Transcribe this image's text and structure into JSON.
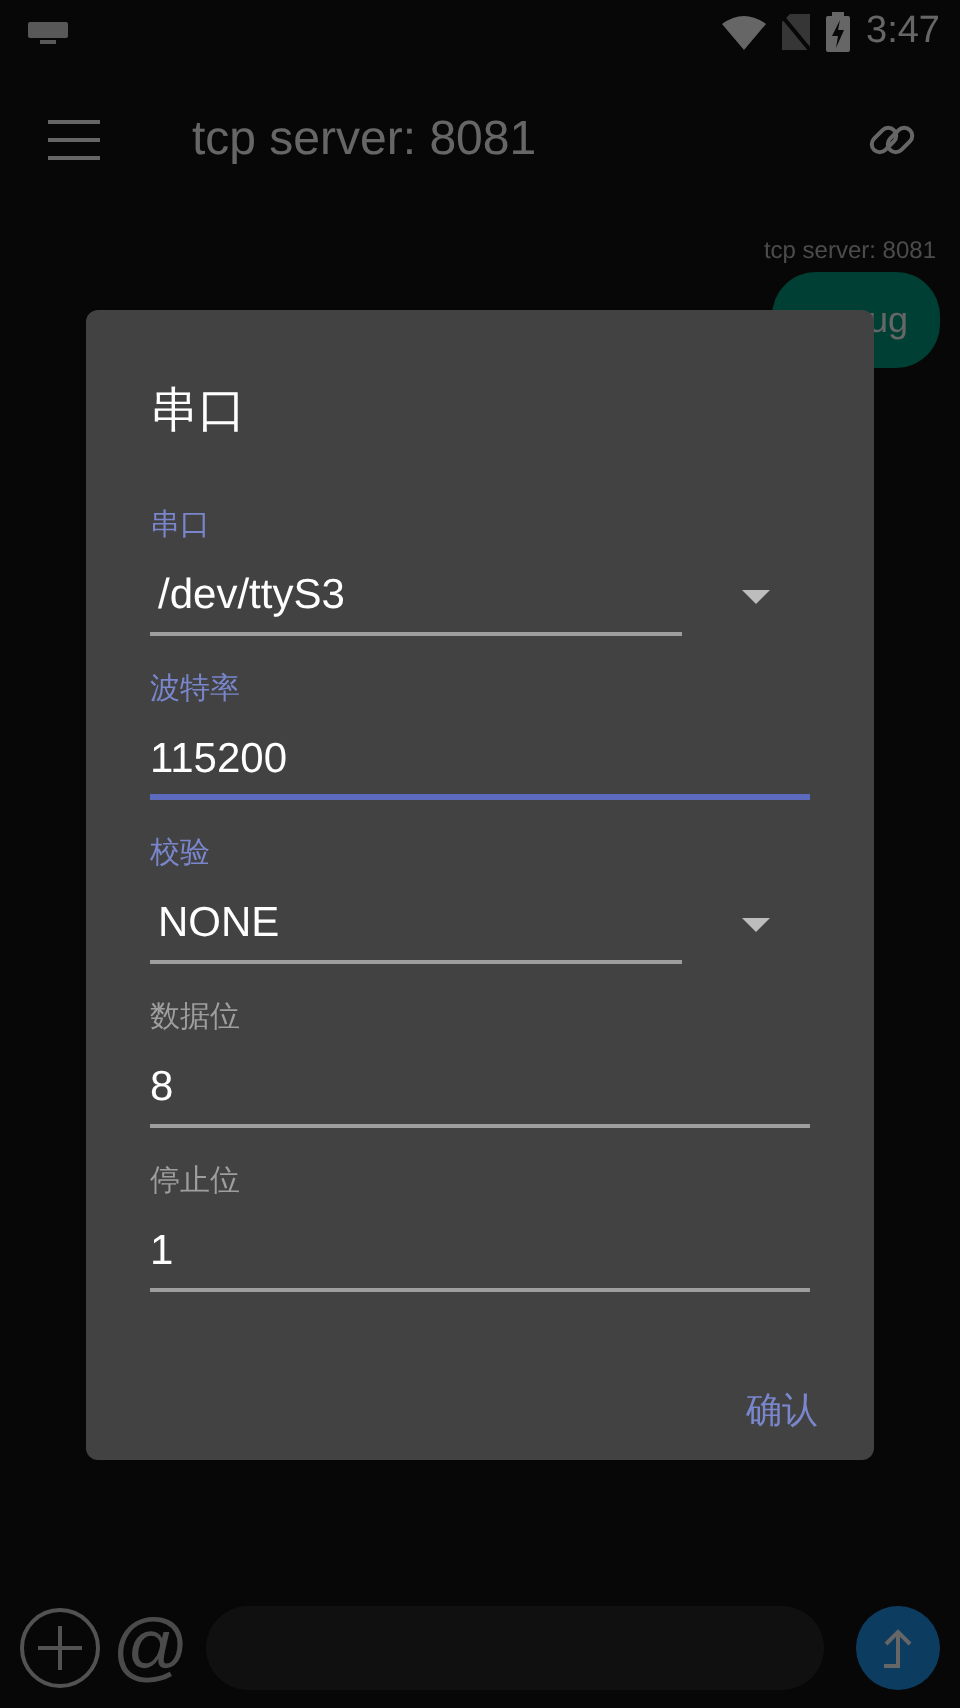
{
  "status_bar": {
    "time": "3:47"
  },
  "toolbar": {
    "title": "tcp server: 8081"
  },
  "messages": [
    {
      "sender": "tcp server: 8081",
      "text": "ug"
    }
  ],
  "dialog": {
    "title": "串口",
    "fields": [
      {
        "kind": "dropdown",
        "label": "串口",
        "value": "/dev/ttyS3",
        "label_accent": true
      },
      {
        "kind": "text",
        "label": "波特率",
        "value": "115200",
        "label_accent": true,
        "focused": true
      },
      {
        "kind": "dropdown",
        "label": "校验",
        "value": "NONE",
        "label_accent": true
      },
      {
        "kind": "text",
        "label": "数据位",
        "value": "8",
        "label_accent": false,
        "focused": false
      },
      {
        "kind": "text",
        "label": "停止位",
        "value": "1",
        "label_accent": false,
        "focused": false
      }
    ],
    "confirm": "确认"
  },
  "input_bar": {
    "mention": "@"
  }
}
